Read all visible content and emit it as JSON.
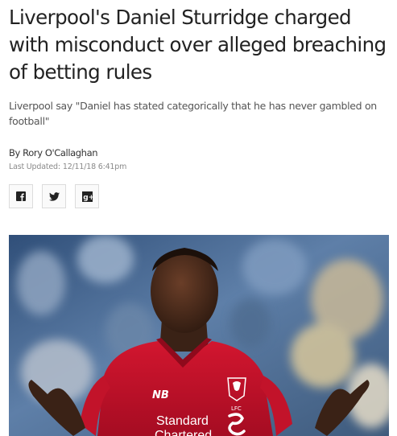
{
  "article": {
    "headline": "Liverpool's Daniel Sturridge charged with misconduct over alleged breaching of betting rules",
    "standfirst": "Liverpool say \"Daniel has stated categorically that he has never gambled on football\"",
    "byline": "By Rory O'Callaghan",
    "last_updated_label": "Last Updated:",
    "last_updated_value": "12/11/18 6:41pm"
  },
  "share": {
    "buttons": [
      {
        "icon": "facebook-icon"
      },
      {
        "icon": "twitter-icon"
      },
      {
        "icon": "share-icon"
      }
    ]
  },
  "hero_image": {
    "shirt_sponsor_line1": "Standard",
    "shirt_sponsor_line2": "Chartered",
    "badge_text": "LFC",
    "shirt_color": "#c8102e",
    "background_colors": [
      "#2f4d74",
      "#6c8fb8",
      "#d9c9a4"
    ]
  }
}
